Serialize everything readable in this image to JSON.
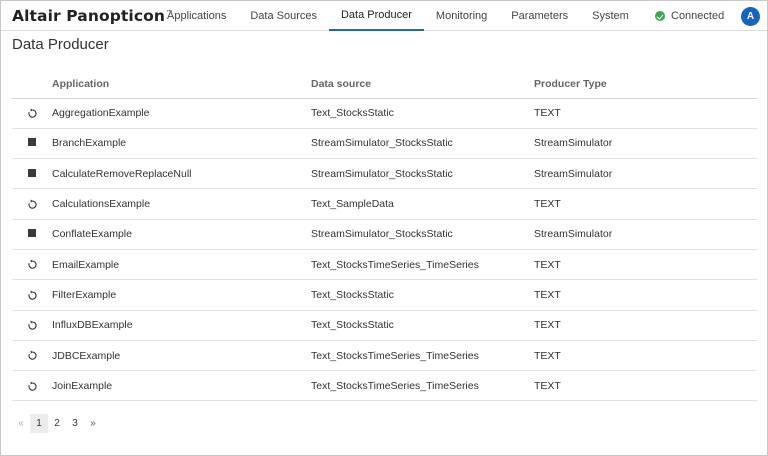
{
  "header": {
    "brand": "Altair Panopticon",
    "brand_mark": "™",
    "nav": [
      "Applications",
      "Data Sources",
      "Data Producer",
      "Monitoring",
      "Parameters",
      "System"
    ],
    "active_tab": "Data Producer",
    "status": "Connected",
    "avatar": "A"
  },
  "page": {
    "title": "Data Producer"
  },
  "table": {
    "columns": [
      "Application",
      "Data source",
      "Producer Type"
    ],
    "rows": [
      {
        "state": "refresh",
        "application": "AggregationExample",
        "source": "Text_StocksStatic",
        "type": "TEXT"
      },
      {
        "state": "stop",
        "application": "BranchExample",
        "source": "StreamSimulator_StocksStatic",
        "type": "StreamSimulator"
      },
      {
        "state": "stop",
        "application": "CalculateRemoveReplaceNull",
        "source": "StreamSimulator_StocksStatic",
        "type": "StreamSimulator"
      },
      {
        "state": "refresh",
        "application": "CalculationsExample",
        "source": "Text_SampleData",
        "type": "TEXT"
      },
      {
        "state": "stop",
        "application": "ConflateExample",
        "source": "StreamSimulator_StocksStatic",
        "type": "StreamSimulator"
      },
      {
        "state": "refresh",
        "application": "EmailExample",
        "source": "Text_StocksTimeSeries_TimeSeries",
        "type": "TEXT"
      },
      {
        "state": "refresh",
        "application": "FilterExample",
        "source": "Text_StocksStatic",
        "type": "TEXT"
      },
      {
        "state": "refresh",
        "application": "InfluxDBExample",
        "source": "Text_StocksStatic",
        "type": "TEXT"
      },
      {
        "state": "refresh",
        "application": "JDBCExample",
        "source": "Text_StocksTimeSeries_TimeSeries",
        "type": "TEXT"
      },
      {
        "state": "refresh",
        "application": "JoinExample",
        "source": "Text_StocksTimeSeries_TimeSeries",
        "type": "TEXT"
      }
    ]
  },
  "pagination": {
    "prev": "«",
    "pages": [
      "1",
      "2",
      "3"
    ],
    "current": "1",
    "next": "»"
  },
  "colors": {
    "accent": "#1f6f8b",
    "connected": "#3aa655",
    "avatar": "#1565c0"
  }
}
